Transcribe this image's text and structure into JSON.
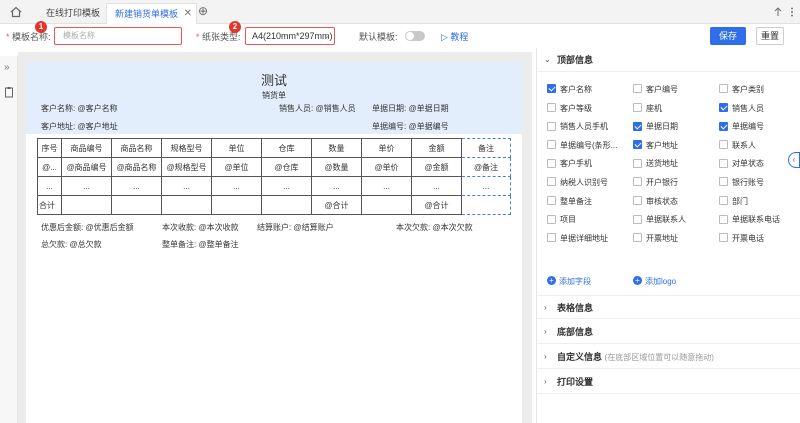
{
  "tabs": {
    "tab1": "在线打印模板",
    "tab2": "新建销货单模板",
    "close_glyph": "✕",
    "add_glyph": "⊕"
  },
  "toolbar": {
    "name_label": "模板名称:",
    "name_placeholder": "模板名称",
    "badge1": "1",
    "paper_label": "纸张类型:",
    "paper_value": "A4(210mm*297mm)",
    "badge2": "2",
    "default_label": "默认模板:",
    "tutorial": "教程",
    "save": "保存",
    "reset": "重置"
  },
  "paper": {
    "title": "测试",
    "subtitle": "销货单",
    "customer_name": "客户名称: @客户名称",
    "salesperson": "销售人员: @销售人员",
    "doc_date": "单据日期: @单据日期",
    "customer_address": "客户地址: @客户地址",
    "doc_number": "单据编号: @单据编号"
  },
  "table": {
    "headers": [
      "序号",
      "商品编号",
      "商品名称",
      "规格型号",
      "单位",
      "仓库",
      "数量",
      "单价",
      "金额",
      "备注"
    ],
    "row1": [
      "@...",
      "@商品编号",
      "@商品名称",
      "@规格型号",
      "@单位",
      "@仓库",
      "@数量",
      "@单价",
      "@金额",
      "@备注"
    ],
    "row2": [
      "...",
      "...",
      "...",
      "...",
      "...",
      "...",
      "...",
      "...",
      "...",
      "..."
    ],
    "total": [
      "合计",
      "",
      "",
      "",
      "",
      "",
      "@合计",
      "",
      "@合计",
      ""
    ]
  },
  "footer": {
    "discount": "优惠后金额: @优惠后金额",
    "received": "本次收款: @本次收款",
    "account": "结算账户: @结算账户",
    "owed": "本次欠款: @本次欠款",
    "total_owed": "总欠款: @总欠款",
    "remark": "整单备注: @整单备注"
  },
  "panel": {
    "sections": {
      "top": "顶部信息",
      "table": "表格信息",
      "bottom": "底部信息",
      "custom": "自定义信息",
      "custom_note": "(在底部区域位置可以随意拖动)",
      "print": "打印设置"
    },
    "fields": [
      {
        "label": "客户名称",
        "checked": true
      },
      {
        "label": "客户编号",
        "checked": false
      },
      {
        "label": "客户类别",
        "checked": false
      },
      {
        "label": "客户等级",
        "checked": false
      },
      {
        "label": "座机",
        "checked": false
      },
      {
        "label": "销售人员",
        "checked": true
      },
      {
        "label": "销售人员手机",
        "checked": false
      },
      {
        "label": "单据日期",
        "checked": true
      },
      {
        "label": "单据编号",
        "checked": true
      },
      {
        "label": "单据编号(条形...",
        "checked": false
      },
      {
        "label": "客户地址",
        "checked": true
      },
      {
        "label": "联系人",
        "checked": false
      },
      {
        "label": "客户手机",
        "checked": false
      },
      {
        "label": "送货地址",
        "checked": false
      },
      {
        "label": "对单状态",
        "checked": false
      },
      {
        "label": "纳税人识别号",
        "checked": false
      },
      {
        "label": "开户银行",
        "checked": false
      },
      {
        "label": "银行账号",
        "checked": false
      },
      {
        "label": "整单备注",
        "checked": false
      },
      {
        "label": "审核状态",
        "checked": false
      },
      {
        "label": "部门",
        "checked": false
      },
      {
        "label": "项目",
        "checked": false
      },
      {
        "label": "单据联系人",
        "checked": false
      },
      {
        "label": "单据联系电话",
        "checked": false
      },
      {
        "label": "单据详细地址",
        "checked": false
      },
      {
        "label": "开票地址",
        "checked": false
      },
      {
        "label": "开票电话",
        "checked": false
      }
    ],
    "add_field": "添加字段",
    "add_logo": "添加logo"
  },
  "colors": {
    "accent": "#2f6ee8",
    "required": "#e55555",
    "badge": "#e5352b",
    "header_bg": "#e2eefb"
  }
}
